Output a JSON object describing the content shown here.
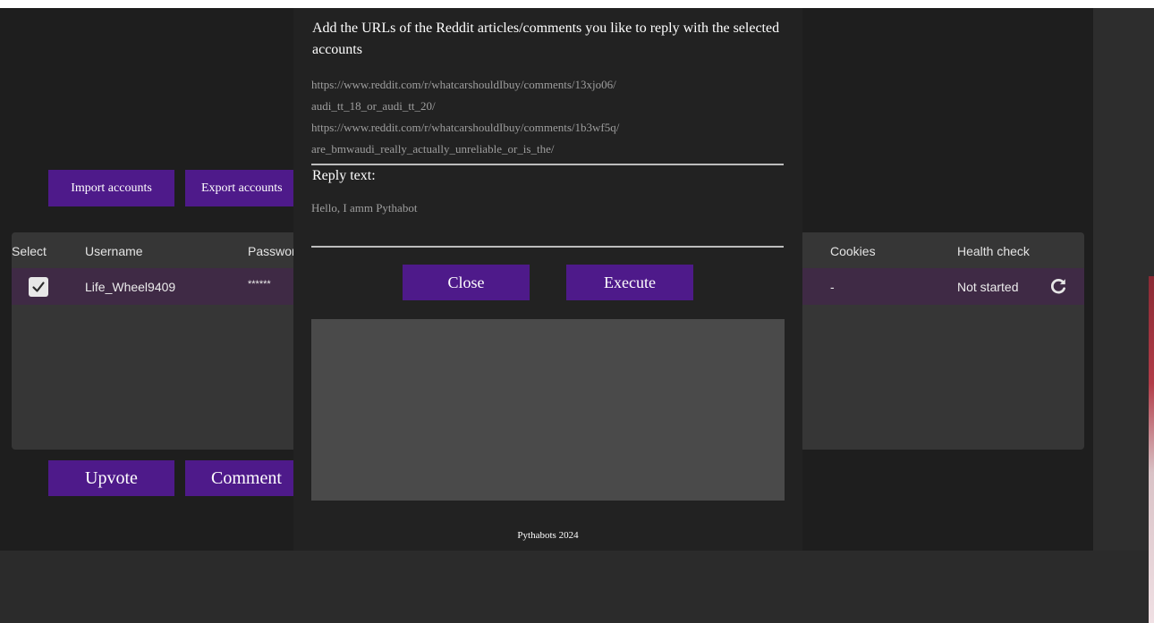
{
  "toolbar": {
    "import_label": "Import accounts",
    "export_label": "Export accounts"
  },
  "table": {
    "headers": {
      "select": "Select",
      "username": "Username",
      "password": "Passwor",
      "cookies": "Cookies",
      "health": "Health check"
    },
    "rows": [
      {
        "checked": true,
        "username": "Life_Wheel9409",
        "password": "******",
        "cookies": "-",
        "health": "Not started"
      }
    ]
  },
  "actions": {
    "upvote_label": "Upvote",
    "comment_label": "Comment"
  },
  "modal": {
    "title": "Add the URLs of the Reddit articles/comments you like to reply with the selected accounts",
    "urls_value": "https://www.reddit.com/r/whatcarshouldIbuy/comments/13xjo06/\naudi_tt_18_or_audi_tt_20/\nhttps://www.reddit.com/r/whatcarshouldIbuy/comments/1b3wf5q/\nare_bmwaudi_really_actually_unreliable_or_is_the/",
    "reply_label": "Reply text:",
    "reply_value": "Hello, I amm Pythabot",
    "close_label": "Close",
    "execute_label": "Execute",
    "footer": "Pythabots 2024"
  },
  "icons": {
    "check": "check-icon",
    "refresh": "refresh-icon"
  },
  "colors": {
    "accent": "#4e1a8a",
    "row_selected": "#3f2a45",
    "modal_bg": "#222222",
    "window_bg": "#1e1e1e"
  }
}
